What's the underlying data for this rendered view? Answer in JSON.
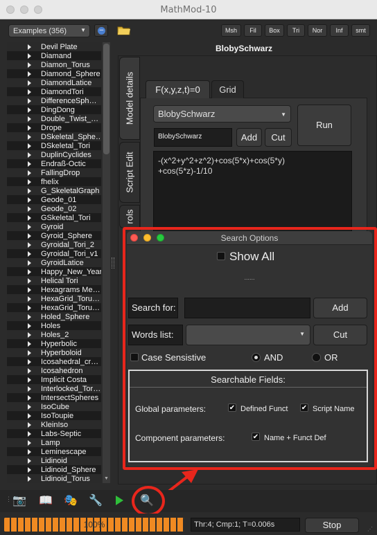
{
  "window_title": "MathMod-10",
  "examples_combo": "Examples (356)",
  "quick_buttons": [
    "Msh",
    "Fil",
    "Box",
    "Tri",
    "Nor",
    "Inf",
    "smt"
  ],
  "list_items": [
    "Devil Plate",
    "Diamand",
    "Diamon_Torus",
    "Diamond_Sphere",
    "DiamondLatice",
    "DiamondTori",
    "DifferenceSph…",
    "DingDong",
    "Double_Twist_…",
    "Drope",
    "DSkeletal_Sphe…",
    "DSkeletal_Tori",
    "DuplinCyclides",
    "Endraß-Octic",
    "FallingDrop",
    "fhelix",
    "G_SkeletalGraph",
    "Geode_01",
    "Geode_02",
    "GSkeletal_Tori",
    "Gyroid",
    "Gyroid_Sphere",
    "Gyroidal_Tori_2",
    "Gyroidal_Tori_v1",
    "GyroidLatice",
    "Happy_New_Year",
    "Helical Tori",
    "Hexagrams Me…",
    "HexaGrid_Toru…",
    "HexaGrid_Toru…",
    "Holed_Sphere",
    "Holes",
    "Holes_2",
    "Hyperbolic",
    "Hyperboloid",
    "Icosahedral_cr…",
    "Icosahedron",
    "Implicit Costa",
    "Interlocked_Tor…",
    "IntersectSpheres",
    "IsoCube",
    "IsoToupie",
    "KleinIso",
    "Labs-Septic",
    "Lamp",
    "Leminescape",
    "Lidinoid",
    "Lidinoid_Sphere",
    "Lidinoid_Torus"
  ],
  "model_title": "BlobySchwarz",
  "vertical_tabs": {
    "model_details": "Model details",
    "script_edit": "Script Edit",
    "controls": "rols"
  },
  "tabs": {
    "function": "F(x,y,z,t)=0",
    "grid": "Grid"
  },
  "model_combo": "BlobySchwarz",
  "name_field": "BlobySchwarz",
  "buttons": {
    "add": "Add",
    "cut": "Cut",
    "run": "Run",
    "stop": "Stop"
  },
  "formula": [
    "-(x^2+y^2+z^2)+cos(5*x)+cos(5*y)",
    "+cos(5*z)-1/10"
  ],
  "search_dialog": {
    "title": "Search Options",
    "show_all": "Show All",
    "dots": "......",
    "search_for_label": "Search for:",
    "search_value": "",
    "add": "Add",
    "words_list_label": "Words list:",
    "cut": "Cut",
    "case_sensitive": "Case Sensistive",
    "and": "AND",
    "or": "OR",
    "fields_title": "Searchable Fields:",
    "global_params": "Global parameters:",
    "defined_funct": "Defined Funct",
    "script_name": "Script Name",
    "component_params": "Component parameters:",
    "name_funct_def": "Name + Funct Def"
  },
  "progress": {
    "label": "100%",
    "value": 100
  },
  "status": "Thr:4; Cmp:1; T=0.006s",
  "colors": {
    "accent": "#e8261c",
    "progress": "#e07a1c"
  }
}
